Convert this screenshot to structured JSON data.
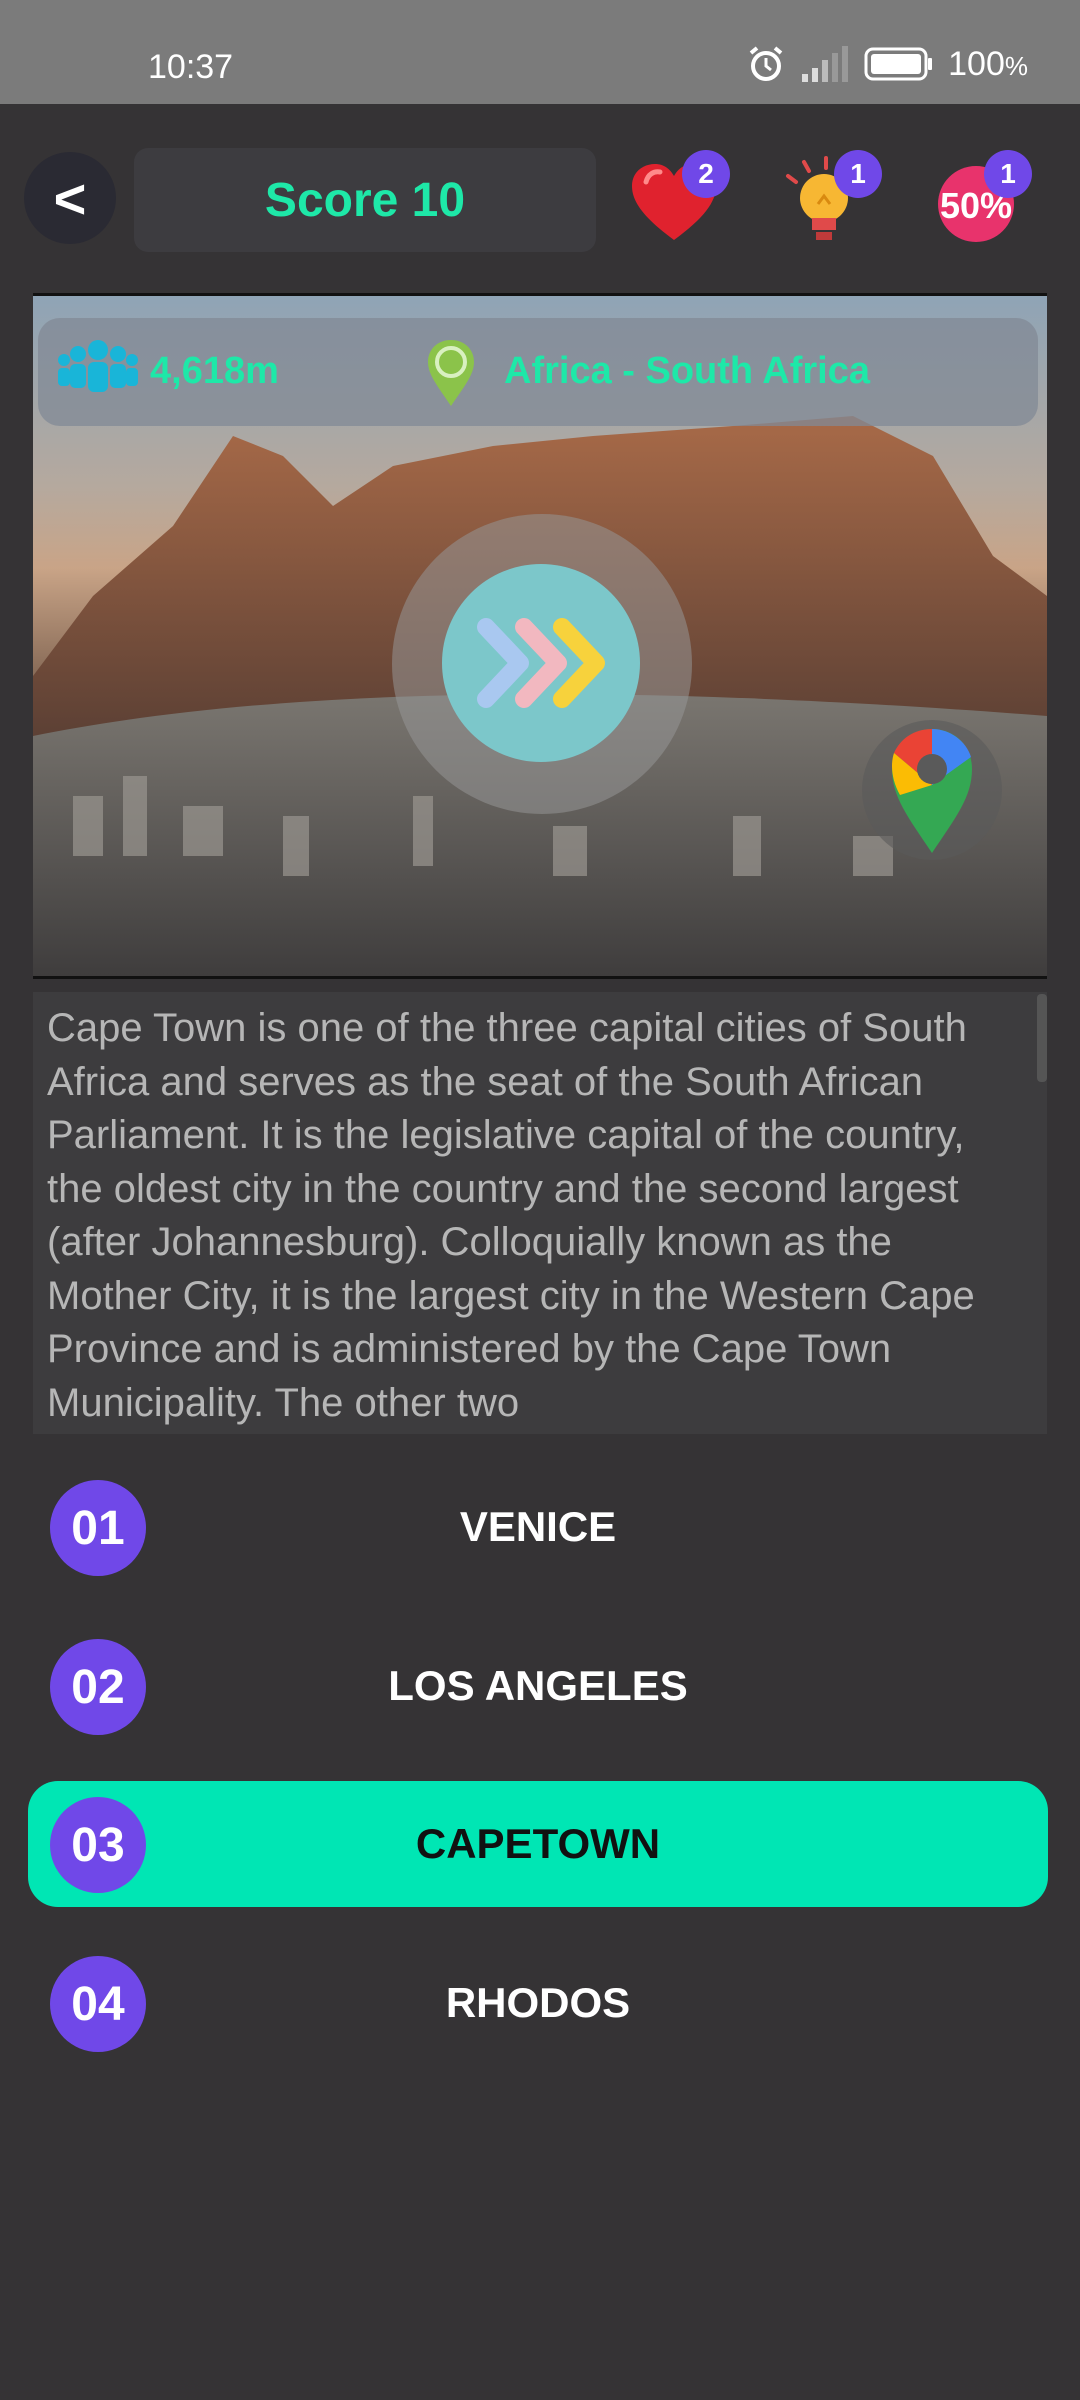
{
  "status_bar": {
    "time": "10:37",
    "battery": "100",
    "battery_unit": "%"
  },
  "header": {
    "back_label": "<",
    "score_label": "Score 10"
  },
  "powerups": [
    {
      "icon": "heart-icon",
      "count": "2"
    },
    {
      "icon": "lightbulb-icon",
      "count": "1"
    },
    {
      "icon": "fifty-percent-icon",
      "count": "1",
      "label": "50%"
    }
  ],
  "hero": {
    "population": "4,618m",
    "location": "Africa - South Africa"
  },
  "description": "Cape Town is one of the three capital cities of South Africa and serves as the seat of the South African Parliament. It is the legislative capital of the country, the oldest city in the country and the second largest (after Johannesburg). Colloquially known as the Mother City, it is the largest city in the Western Cape Province and is administered by the Cape Town Municipality. The other two",
  "answers": [
    {
      "number": "01",
      "label": "VENICE",
      "selected": false
    },
    {
      "number": "02",
      "label": "LOS ANGELES",
      "selected": false
    },
    {
      "number": "03",
      "label": "CAPETOWN",
      "selected": true
    },
    {
      "number": "04",
      "label": "RHODOS",
      "selected": false
    }
  ],
  "colors": {
    "accent": "#1ee8a8",
    "selected": "#00e6b4",
    "badge": "#7048e8",
    "background": "#353335"
  }
}
